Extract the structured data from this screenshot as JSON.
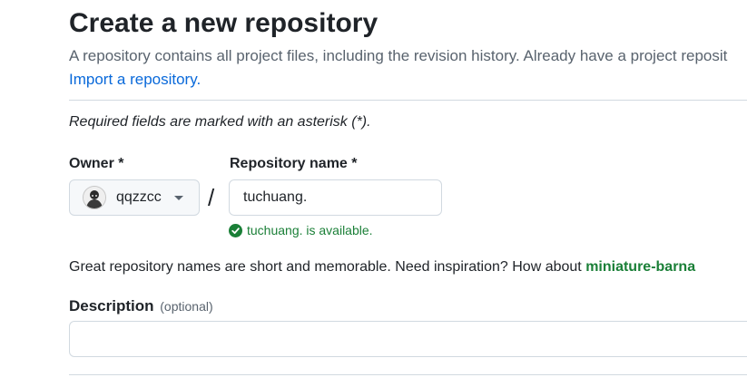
{
  "header": {
    "title": "Create a new repository",
    "subtitle": "A repository contains all project files, including the revision history. Already have a project reposit",
    "import_link": "Import a repository."
  },
  "form": {
    "required_note": "Required fields are marked with an asterisk (*).",
    "owner": {
      "label": "Owner *",
      "value": "qqzzcc"
    },
    "separator": "/",
    "repo_name": {
      "label": "Repository name *",
      "value": "tuchuang."
    },
    "availability": {
      "text": "tuchuang. is available.",
      "color": "#1a7f37"
    },
    "inspiration": {
      "text": "Great repository names are short and memorable. Need inspiration? How about",
      "suggestion": "miniature-barna"
    },
    "description": {
      "label": "Description",
      "optional": "(optional)",
      "value": ""
    }
  },
  "icons": {
    "availability": "check-circle-icon",
    "owner_dropdown": "caret-down-icon"
  },
  "colors": {
    "link": "#0969da",
    "success": "#1a7f37",
    "muted": "#59636e",
    "border": "#d1d9e0"
  }
}
